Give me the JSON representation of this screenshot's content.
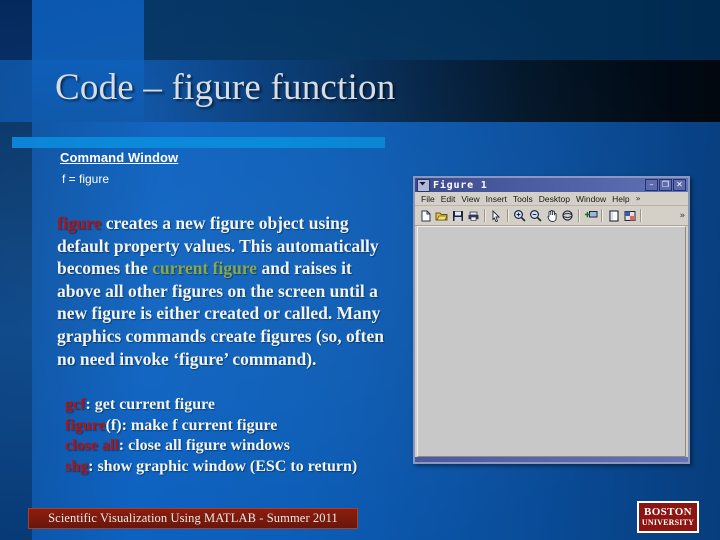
{
  "slide": {
    "title": "Code – figure function",
    "command_window": {
      "header": "Command Window",
      "prompt_line": "f = figure"
    },
    "body": {
      "seg1_keyword": "figure",
      "seg2": " creates a new figure object using default property values. This automatically becomes the ",
      "seg3_keyword": "current figure",
      "seg4": " and raises it above all other figures on the screen until a new figure is either created or called. Many graphics commands create figures (so, often no need invoke ‘figure’ command)."
    },
    "commands": [
      {
        "keyword": "gcf",
        "description": ": get current figure"
      },
      {
        "keyword": "figure",
        "description": "(f): make f current figure"
      },
      {
        "keyword": "close all",
        "description": ": close all figure windows"
      },
      {
        "keyword": "shg",
        "description": ": show graphic window (ESC to return)"
      }
    ],
    "footer": {
      "text": "Scientific Visualization Using MATLAB - Summer 2011"
    },
    "logo": {
      "line1": "BOSTON",
      "line2": "UNIVERSITY"
    },
    "colors": {
      "keyword_red": "#b01515",
      "keyword_green": "#8aa84a",
      "accent_bar": "#0a8ad8",
      "footer_bg": "#7a1a0d",
      "logo_bg": "#8c1512",
      "slide_bg": "#0a58ad"
    }
  },
  "figure_window": {
    "title": "Figure 1",
    "titlebar_buttons": [
      {
        "name": "minimize",
        "glyph": "–"
      },
      {
        "name": "restore",
        "glyph": "❐"
      },
      {
        "name": "close",
        "glyph": "✕"
      }
    ],
    "menus": [
      "File",
      "Edit",
      "View",
      "Insert",
      "Tools",
      "Desktop",
      "Window",
      "Help"
    ],
    "menu_overflow": "»",
    "toolbar": [
      {
        "name": "new-figure-icon",
        "glyph": "🗋"
      },
      {
        "name": "open-file-icon",
        "glyph": "📂"
      },
      {
        "name": "save-figure-icon",
        "glyph": "🖫"
      },
      {
        "name": "print-figure-icon",
        "glyph": "🖨"
      },
      {
        "separator": true
      },
      {
        "name": "edit-plot-pointer-icon",
        "glyph": "↖"
      },
      {
        "separator": true
      },
      {
        "name": "zoom-in-icon",
        "glyph": "⊕"
      },
      {
        "name": "zoom-out-icon",
        "glyph": "⊖"
      },
      {
        "name": "pan-icon",
        "glyph": "✋"
      },
      {
        "name": "rotate-3d-icon",
        "glyph": "⟳"
      },
      {
        "separator": true
      },
      {
        "name": "data-cursor-icon",
        "glyph": "⊞"
      },
      {
        "separator": true
      },
      {
        "name": "insert-colorbar-icon",
        "glyph": "▯"
      },
      {
        "name": "insert-legend-icon",
        "glyph": "▦"
      },
      {
        "separator": true
      }
    ],
    "toolbar_overflow": "»"
  }
}
